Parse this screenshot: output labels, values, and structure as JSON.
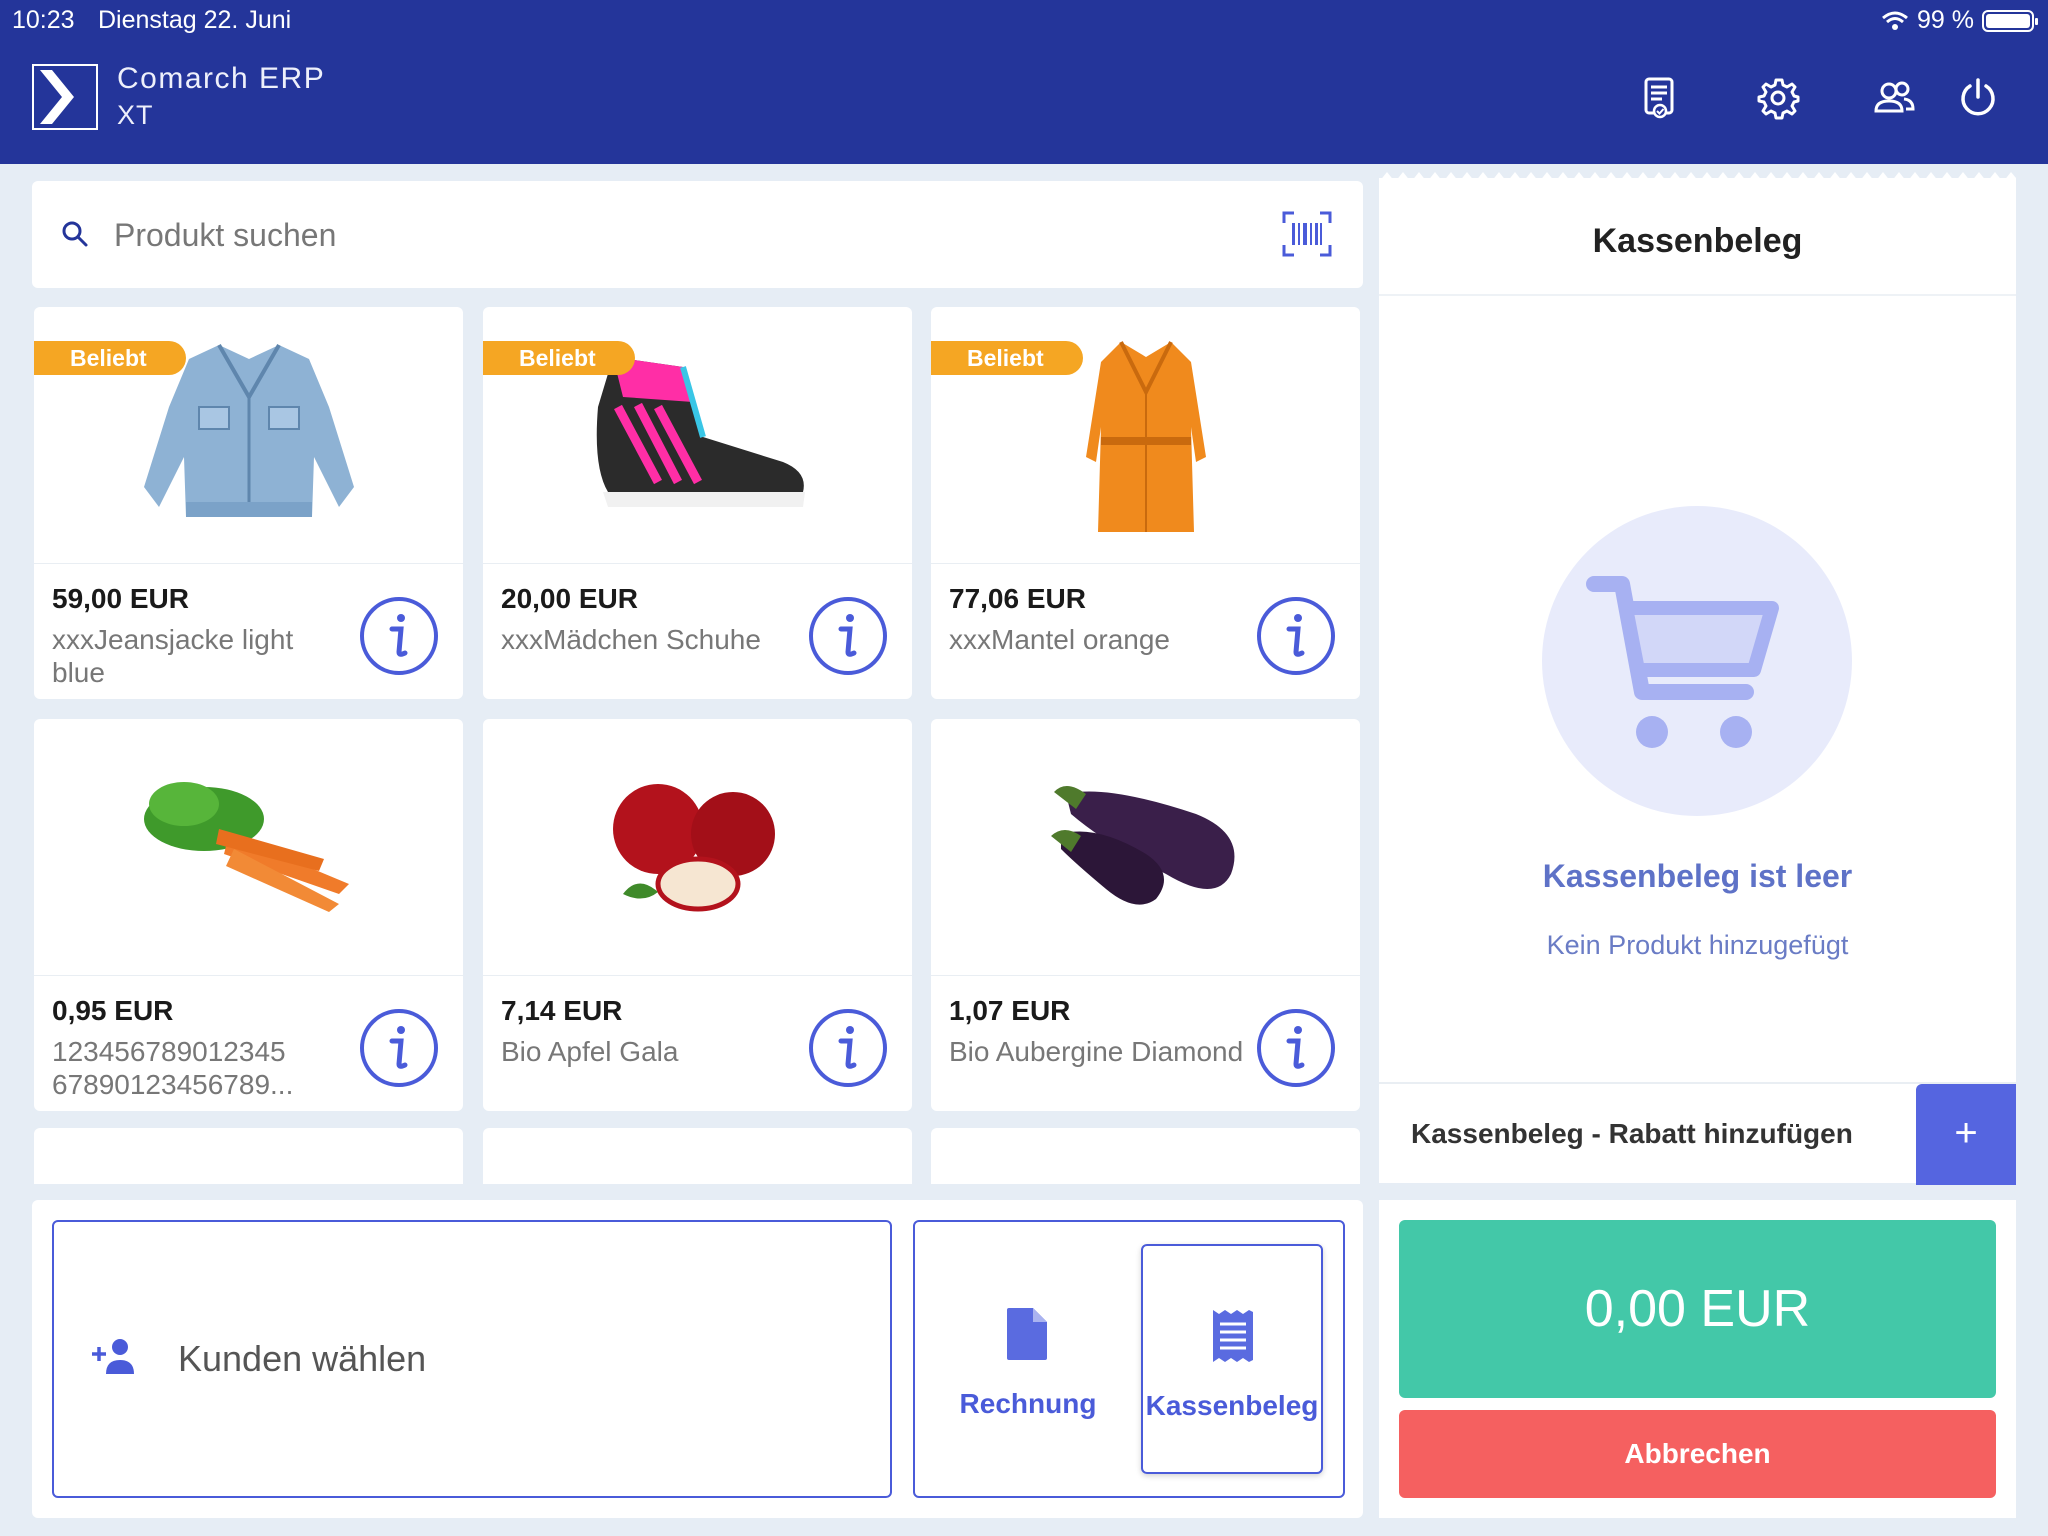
{
  "status_bar": {
    "time": "10:23",
    "date": "Dienstag 22. Juni",
    "battery": "99 %"
  },
  "app": {
    "brand_line1": "Comarch ERP",
    "brand_line2": "XT"
  },
  "header_icons": [
    "receipt-list-icon",
    "settings-gear-icon",
    "users-icon",
    "power-icon"
  ],
  "search": {
    "placeholder": "Produkt suchen"
  },
  "products": [
    {
      "badge": "Beliebt",
      "price": "59,00 EUR",
      "name": "xxxJeansjacke light blue"
    },
    {
      "badge": "Beliebt",
      "price": "20,00 EUR",
      "name": "xxxMädchen Schuhe"
    },
    {
      "badge": "Beliebt",
      "price": "77,06 EUR",
      "name": "xxxMantel orange"
    },
    {
      "price": "0,95 EUR",
      "name": "123456789012345 67890123456789..."
    },
    {
      "price": "7,14 EUR",
      "name": "Bio Apfel Gala"
    },
    {
      "price": "1,07 EUR",
      "name": "Bio Aubergine Diamond"
    }
  ],
  "customer": {
    "label": "Kunden wählen"
  },
  "document_types": {
    "invoice": "Rechnung",
    "receipt": "Kassenbeleg",
    "selected": "Kassenbeleg"
  },
  "receipt": {
    "title": "Kassenbeleg",
    "empty_title": "Kassenbeleg ist leer",
    "empty_subtitle": "Kein Produkt hinzugefügt",
    "discount_label": "Kassenbeleg - Rabatt hinzufügen",
    "discount_add": "+"
  },
  "total": "0,00 EUR",
  "cancel_label": "Abbrechen",
  "colors": {
    "header": "#24359a",
    "accent": "#4a5bd9",
    "badge": "#f5a623",
    "total": "#43c8a8",
    "cancel": "#f56060"
  }
}
